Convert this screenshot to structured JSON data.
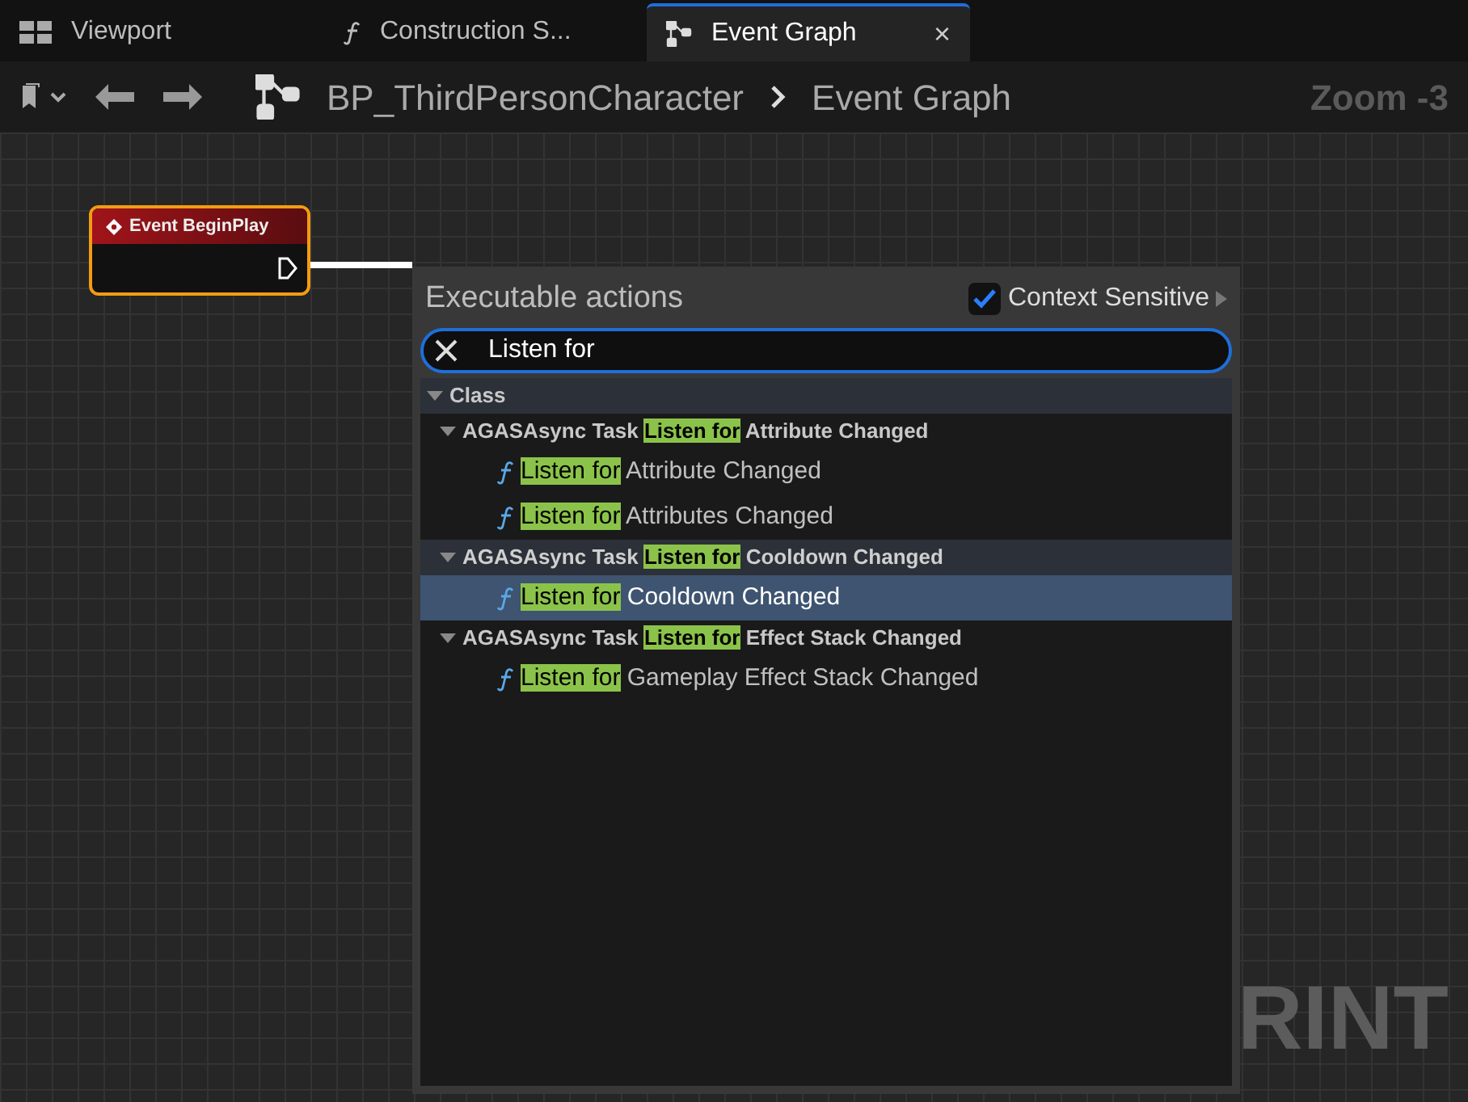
{
  "tabs": [
    {
      "label": "Viewport",
      "kind": "viewport",
      "selected": false
    },
    {
      "label": "Construction S...",
      "kind": "function",
      "selected": false
    },
    {
      "label": "Event Graph",
      "kind": "graph",
      "selected": true,
      "close": "×"
    }
  ],
  "toolbar": {
    "breadcrumb": [
      "BP_ThirdPersonCharacter",
      "Event Graph"
    ],
    "zoom": "Zoom -3"
  },
  "node": {
    "title": "Event BeginPlay",
    "selected": true
  },
  "canvas_watermark": "RINT",
  "menu": {
    "title": "Executable actions",
    "context_sensitive": {
      "label": "Context Sensitive",
      "checked": true
    },
    "search": {
      "value": "Listen for"
    },
    "tree": [
      {
        "label": "Class",
        "expanded": true,
        "children": [
          {
            "prefix": "AGASAsync Task",
            "match": "Listen for",
            "rest": "Attribute Changed",
            "expanded": true,
            "selected": false,
            "children": [
              {
                "match": "Listen for",
                "rest": "Attribute Changed",
                "selected": false
              },
              {
                "match": "Listen for",
                "rest": "Attributes Changed",
                "selected": false
              }
            ]
          },
          {
            "prefix": "AGASAsync Task",
            "match": "Listen for",
            "rest": "Cooldown Changed",
            "expanded": true,
            "selected": true,
            "children": [
              {
                "match": "Listen for",
                "rest": "Cooldown Changed",
                "selected": true
              }
            ]
          },
          {
            "prefix": "AGASAsync Task",
            "match": "Listen for",
            "rest": "Effect Stack Changed",
            "expanded": true,
            "selected": false,
            "children": [
              {
                "match": "Listen for",
                "rest": "Gameplay Effect Stack Changed",
                "selected": false
              }
            ]
          }
        ]
      }
    ]
  }
}
